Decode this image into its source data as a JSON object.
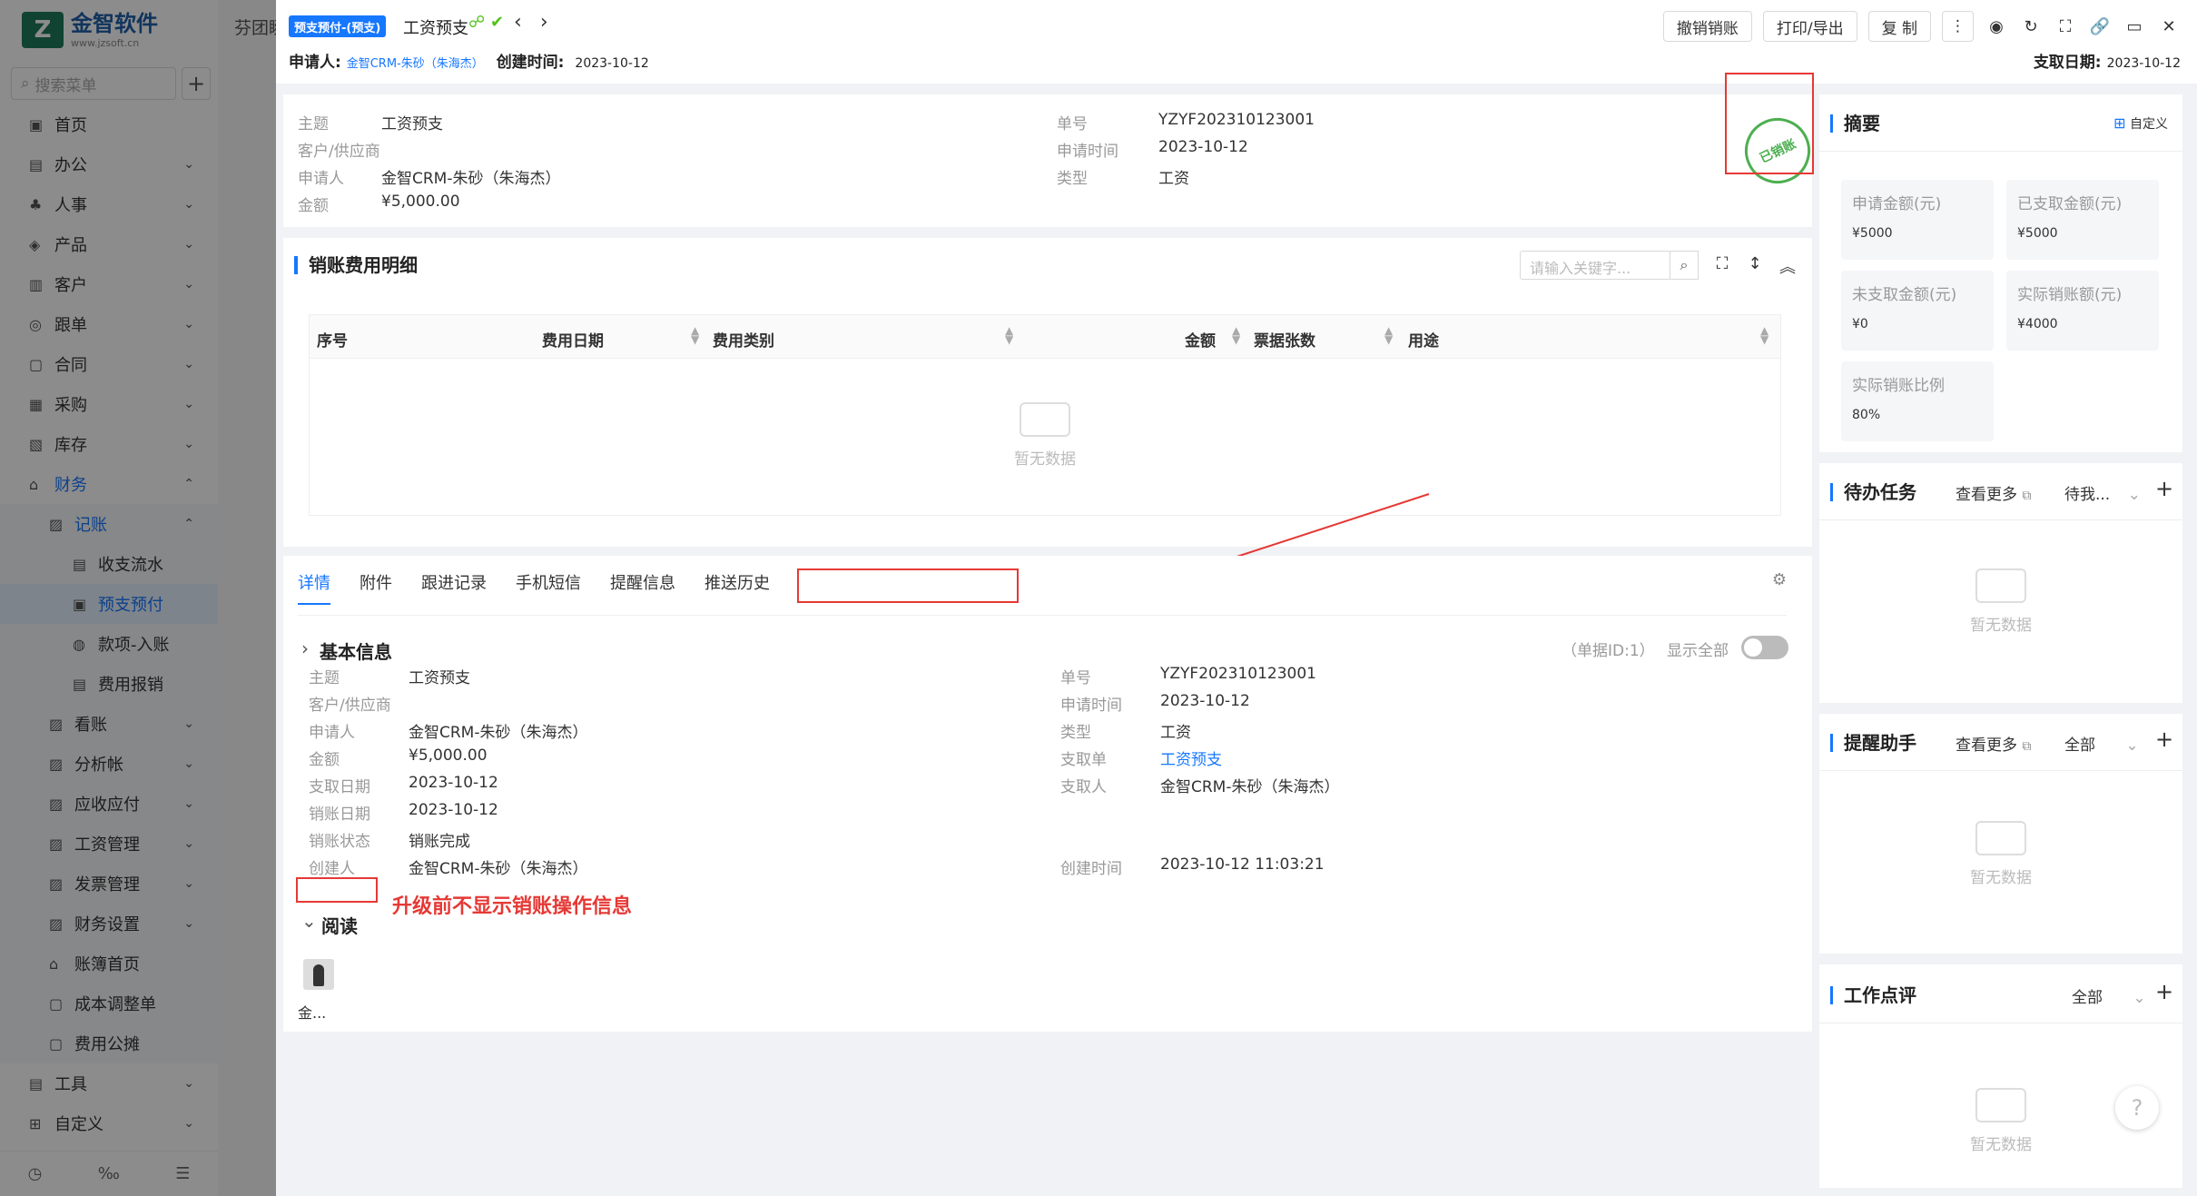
{
  "sidebar": {
    "logo_mark": "Z",
    "logo_cn": "金智软件",
    "logo_en": "www.jzsoft.cn",
    "search_placeholder": "搜索菜单",
    "plus": "+",
    "items": [
      {
        "label": "首页",
        "icon": "▣",
        "level": 0
      },
      {
        "label": "办公",
        "icon": "▤",
        "level": 0,
        "chev": "⌄"
      },
      {
        "label": "人事",
        "icon": "♣",
        "level": 0,
        "chev": "⌄"
      },
      {
        "label": "产品",
        "icon": "◈",
        "level": 0,
        "chev": "⌄"
      },
      {
        "label": "客户",
        "icon": "▥",
        "level": 0,
        "chev": "⌄"
      },
      {
        "label": "跟单",
        "icon": "◎",
        "level": 0,
        "chev": "⌄"
      },
      {
        "label": "合同",
        "icon": "▢",
        "level": 0,
        "chev": "⌄"
      },
      {
        "label": "采购",
        "icon": "▦",
        "level": 0,
        "chev": "⌄"
      },
      {
        "label": "库存",
        "icon": "▧",
        "level": 0,
        "chev": "⌄"
      },
      {
        "label": "财务",
        "icon": "⌂",
        "level": 0,
        "chev": "⌃",
        "active": true
      },
      {
        "label": "记账",
        "icon": "▨",
        "level": 1,
        "chev": "⌃",
        "active": true
      },
      {
        "label": "收支流水",
        "icon": "▤",
        "level": 2
      },
      {
        "label": "预支预付",
        "icon": "▣",
        "level": 2,
        "selected": true
      },
      {
        "label": "款项-入账",
        "icon": "◍",
        "level": 2
      },
      {
        "label": "费用报销",
        "icon": "▤",
        "level": 2
      },
      {
        "label": "看账",
        "icon": "▨",
        "level": 1,
        "chev": "⌄"
      },
      {
        "label": "分析帐",
        "icon": "▨",
        "level": 1,
        "chev": "⌄"
      },
      {
        "label": "应收应付",
        "icon": "▨",
        "level": 1,
        "chev": "⌄"
      },
      {
        "label": "工资管理",
        "icon": "▨",
        "level": 1,
        "chev": "⌄"
      },
      {
        "label": "发票管理",
        "icon": "▨",
        "level": 1,
        "chev": "⌄"
      },
      {
        "label": "财务设置",
        "icon": "▨",
        "level": 1,
        "chev": "⌄"
      },
      {
        "label": "账簿首页",
        "icon": "⌂",
        "level": 1
      },
      {
        "label": "成本调整单",
        "icon": "▢",
        "level": 1
      },
      {
        "label": "费用公摊",
        "icon": "▢",
        "level": 1
      },
      {
        "label": "工具",
        "icon": "▤",
        "level": 0,
        "chev": "⌄"
      },
      {
        "label": "自定义",
        "icon": "⊞",
        "level": 0,
        "chev": "⌄"
      }
    ],
    "bottom_icons": [
      "◷",
      "‰",
      "☰"
    ]
  },
  "strip": {
    "top_text": "芬团瞬"
  },
  "header": {
    "tag": "预支预付-(预支)",
    "title": "工资预支",
    "status_icons": "☍ ✔",
    "nav_prev": "‹",
    "nav_next": "›",
    "applicant_label": "申请人:",
    "applicant": "金智CRM-朱砂（朱海杰）",
    "created_label": "创建时间:",
    "created": "2023-10-12",
    "paydate_label": "支取日期:",
    "paydate": "2023-10-12",
    "buttons": [
      "撤销销账",
      "打印/导出",
      "复 制"
    ],
    "more": "⋮",
    "tool_icons": [
      "◉",
      "↻",
      "⛶",
      "🔗",
      "▭",
      "✕"
    ]
  },
  "summary": {
    "fields_left": [
      {
        "label": "主题",
        "value": "工资预支"
      },
      {
        "label": "客户/供应商",
        "value": ""
      },
      {
        "label": "申请人",
        "value": "金智CRM-朱砂（朱海杰）"
      },
      {
        "label": "金额",
        "value": "¥5,000.00"
      }
    ],
    "fields_right": [
      {
        "label": "单号",
        "value": "YZYF202310123001"
      },
      {
        "label": "申请时间",
        "value": "2023-10-12"
      },
      {
        "label": "类型",
        "value": "工资"
      }
    ],
    "stamp": "已销账"
  },
  "expense": {
    "title": "销账费用明细",
    "search_placeholder": "请输入关键字...",
    "search_icon": "⌕",
    "icons": [
      "⛶",
      "↕",
      "︽"
    ],
    "columns": [
      "序号",
      "费用日期",
      "费用类别",
      "金额",
      "票据张数",
      "用途"
    ],
    "empty": "暂无数据"
  },
  "tabs": {
    "items": [
      "详情",
      "附件",
      "跟进记录",
      "手机短信",
      "提醒信息",
      "推送历史"
    ],
    "settings_icon": "⚙"
  },
  "basic": {
    "title": "基本信息",
    "expander": "›",
    "doc_id": "（单据ID:1）",
    "show_all": "显示全部",
    "fields_left": [
      {
        "label": "主题",
        "value": "工资预支"
      },
      {
        "label": "客户/供应商",
        "value": ""
      },
      {
        "label": "申请人",
        "value": "金智CRM-朱砂（朱海杰）"
      },
      {
        "label": "金额",
        "value": "¥5,000.00"
      },
      {
        "label": "支取日期",
        "value": "2023-10-12"
      },
      {
        "label": "销账日期",
        "value": "2023-10-12"
      },
      {
        "label": "销账状态",
        "value": "销账完成"
      },
      {
        "label": "创建人",
        "value": "金智CRM-朱砂（朱海杰）"
      }
    ],
    "fields_right": [
      {
        "label": "单号",
        "value": "YZYF202310123001"
      },
      {
        "label": "申请时间",
        "value": "2023-10-12"
      },
      {
        "label": "类型",
        "value": "工资"
      },
      {
        "label": "支取单",
        "value": "工资预支",
        "link": true
      },
      {
        "label": "支取人",
        "value": "金智CRM-朱砂（朱海杰）"
      },
      {
        "label": "创建时间",
        "value": "2023-10-12 11:03:21"
      }
    ],
    "annotation": "升级前不显示销账操作信息",
    "read_title": "阅读",
    "read_expander": "⌄",
    "reader_name": "金..."
  },
  "right": {
    "summary_title": "摘要",
    "custom": "自定义",
    "custom_icon": "⊞",
    "stats": [
      {
        "label": "申请金额(元)",
        "value": "¥5000"
      },
      {
        "label": "已支取金额(元)",
        "value": "¥5000"
      },
      {
        "label": "未支取金额(元)",
        "value": "¥0"
      },
      {
        "label": "实际销账额(元)",
        "value": "¥4000"
      },
      {
        "label": "实际销账比例",
        "value": "80%"
      }
    ],
    "todo": {
      "title": "待办任务",
      "more": "查看更多",
      "filter": "待我...",
      "empty": "暂无数据"
    },
    "reminder": {
      "title": "提醒助手",
      "more": "查看更多",
      "filter": "全部",
      "empty": "暂无数据"
    },
    "review": {
      "title": "工作点评",
      "filter": "全部",
      "empty": "暂无数据"
    },
    "plus": "+",
    "chev": "⌄",
    "ext_icon": "⧉",
    "help": "?"
  },
  "colors": {
    "accent": "#1677ff",
    "annotation": "#e53935",
    "stamp": "#4caf50"
  }
}
